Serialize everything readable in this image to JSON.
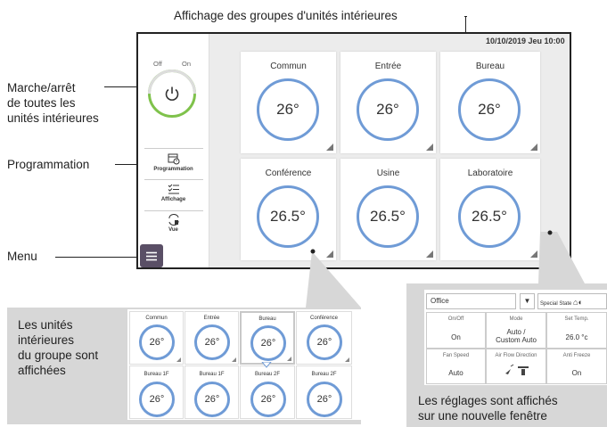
{
  "callouts": {
    "groups_display": "Affichage des groupes d'unités intérieures",
    "onoff_all": [
      "Marche/arrêt",
      "de toutes les",
      "unités intérieures"
    ],
    "programmation": "Programmation",
    "menu": "Menu",
    "group_units": [
      "Les unités",
      "intérieures",
      "du groupe sont",
      "affichées"
    ],
    "settings_window": [
      "Les réglages sont affichés",
      "sur une nouvelle fenêtre"
    ]
  },
  "screen": {
    "datetime": "10/10/2019 Jeu 10:00",
    "power": {
      "off_label": "Off",
      "on_label": "On"
    },
    "sidebar": {
      "programmation": "Programmation",
      "affichage": "Affichage",
      "vue": "Vue"
    },
    "tiles": [
      {
        "name": "Commun",
        "temp": "26°"
      },
      {
        "name": "Entrée",
        "temp": "26°"
      },
      {
        "name": "Bureau",
        "temp": "26°"
      },
      {
        "name": "Conférence",
        "temp": "26.5°"
      },
      {
        "name": "Usine",
        "temp": "26.5°"
      },
      {
        "name": "Laboratoire",
        "temp": "26.5°"
      }
    ]
  },
  "group_grid": [
    {
      "name": "Commun",
      "temp": "26°"
    },
    {
      "name": "Entrée",
      "temp": "26°"
    },
    {
      "name": "Bureau",
      "temp": "26°"
    },
    {
      "name": "Conférence",
      "temp": "26°"
    },
    {
      "name": "Bureau 1F",
      "temp": "26°"
    },
    {
      "name": "Bureau 1F",
      "temp": "26°"
    },
    {
      "name": "Bureau 2F",
      "temp": "26°"
    },
    {
      "name": "Bureau 2F",
      "temp": "26°"
    }
  ],
  "settings": {
    "group_name": "Office",
    "special_state": "Special State",
    "cells": [
      {
        "header": "On/Off",
        "value": "On"
      },
      {
        "header": "Mode",
        "value": "Auto /\nCustom Auto"
      },
      {
        "header": "Set Temp.",
        "value": "26.0 °c"
      },
      {
        "header": "Fan Speed",
        "value": "Auto"
      },
      {
        "header": "Air Flow Direction",
        "value": ""
      },
      {
        "header": "Anti Freeze",
        "value": "On"
      }
    ]
  },
  "colors": {
    "ring": "#6f9bd6",
    "power_on": "#7fc24b",
    "menu": "#5a4f66"
  }
}
